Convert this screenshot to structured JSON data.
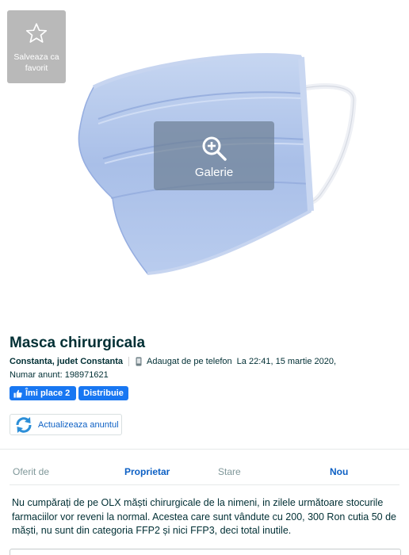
{
  "photo": {
    "favorite_label": "Salveaza ca favorit",
    "favorite_icon": "star-outline-icon",
    "gallery_label": "Galerie",
    "gallery_icon": "zoom-in-icon"
  },
  "ad": {
    "title": "Masca chirurgicala",
    "location": "Constanta, judet Constanta",
    "source": "Adaugat de pe telefon",
    "source_icon": "phone-icon",
    "date": "La 22:41, 15 martie 2020,",
    "ad_number": "Numar anunt: 198971621"
  },
  "social": {
    "like_label": "Îmi place 2",
    "like_icon": "thumbs-up-icon",
    "share_label": "Distribuie"
  },
  "actions": {
    "refresh_label": "Actualizeaza anuntul",
    "refresh_icon": "refresh-icon"
  },
  "details": {
    "offered_by_label": "Oferit de",
    "offered_by_value": "Proprietar",
    "condition_label": "Stare",
    "condition_value": "Nou"
  },
  "description": "Nu cumpărați de pe OLX măști chirurgicale de la nimeni, in zilele următoare stocurile farmaciilor vor reveni la normal. Acestea care sunt vândute cu 200, 300 Ron cutia 50 de măști, nu sunt din categoria FFP2 și nici FFP3, deci total inutile.",
  "colors": {
    "brand_text": "#002f34",
    "link_blue": "#0d60c4",
    "facebook_blue": "#1877f2",
    "mask_blue": "#aec3ea"
  }
}
